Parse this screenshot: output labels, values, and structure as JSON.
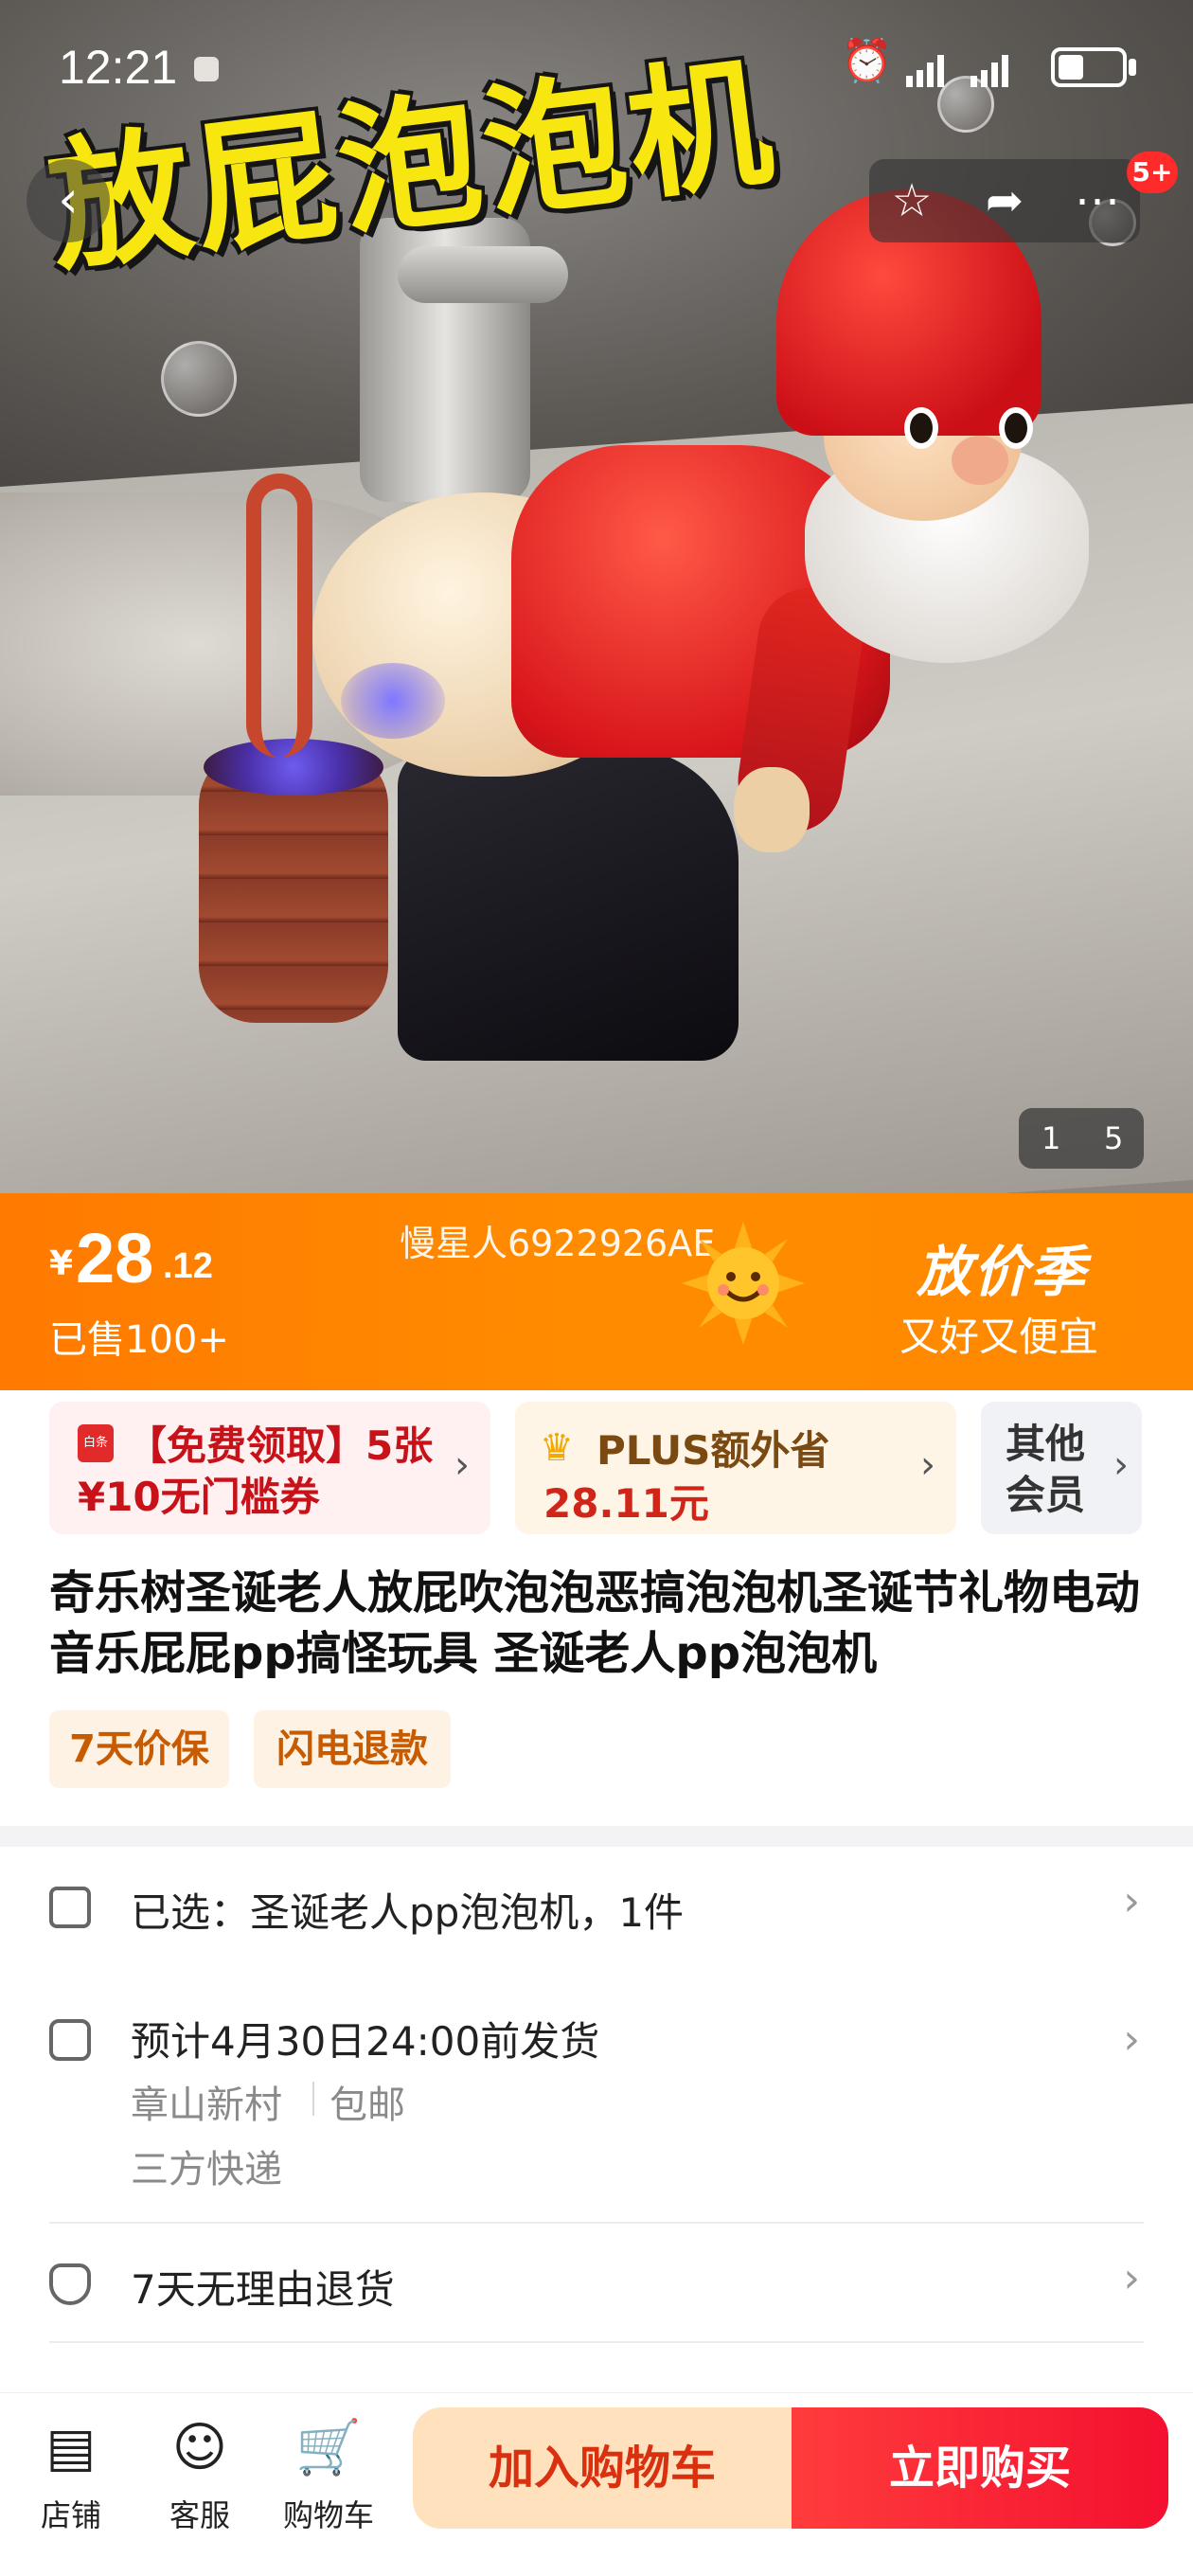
{
  "status_bar": {
    "time": "12:21"
  },
  "hero": {
    "overlay_text": "放屁泡泡机",
    "cart_badge": "5+",
    "pager_current": "1",
    "pager_total": "5"
  },
  "price_banner": {
    "currency": "¥",
    "price_int": "28",
    "price_dec": ".12",
    "sold": "已售100+",
    "watermark": "慢星人6922926AE",
    "promo_title": "放价季",
    "promo_sub": "又好又便宜"
  },
  "coupons": {
    "free": "【免费领取】5张¥10无门槛券",
    "free_tag": "白条",
    "plus_line1": "PLUS额外省",
    "plus_line2": "28.11元",
    "member": "其他会员"
  },
  "product": {
    "title": "奇乐树圣诞老人放屁吹泡泡恶搞泡泡机圣诞节礼物电动音乐屁屁pp搞怪玩具 圣诞老人pp泡泡机",
    "tags": [
      "7天价保",
      "闪电退款"
    ]
  },
  "info": {
    "selected": "已选：圣诞老人pp泡泡机，1件",
    "ship_time": "预计4月30日24:00前发货",
    "ship_from": "章山新村",
    "ship_fee": "包邮",
    "courier": "三方快递",
    "return_policy": "7天无理由退货"
  },
  "bottom_bar": {
    "store": "店铺",
    "service": "客服",
    "cart": "购物车",
    "add_to_cart": "加入购物车",
    "buy_now": "立即购买"
  },
  "colors": {
    "banner_orange": "#ff8400",
    "buy_red": "#f4102f",
    "cart_peach": "#ffe1be"
  }
}
